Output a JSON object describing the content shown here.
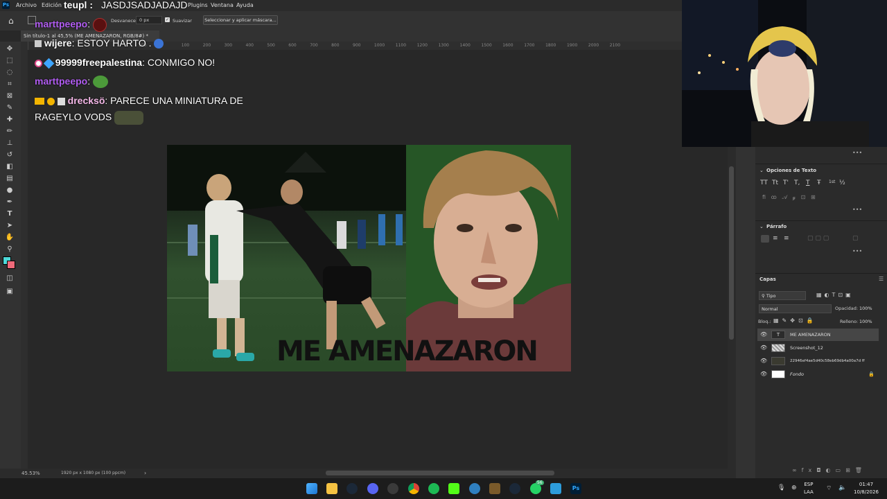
{
  "menu": {
    "items": [
      "Archivo",
      "Edición",
      "Plugins",
      "Ventana",
      "Ayuda"
    ],
    "overlay_title": "JASDJSADJADAJD"
  },
  "options_bar": {
    "feather_label": "Desvanecer:",
    "feather_value": "0 px",
    "smooth_label": "Suavizar",
    "mask_button": "Seleccionar y aplicar máscara..."
  },
  "document_tab": "Sin título-1 al 45,5% (ME AMENAZARON, RGB/8#) *",
  "ruler_ticks": [
    "100",
    "0",
    "100",
    "200",
    "300",
    "400",
    "500",
    "600",
    "700",
    "800",
    "900",
    "1000",
    "1100",
    "1200",
    "1300",
    "1400",
    "1500",
    "1600",
    "1700",
    "1800",
    "1900",
    "2000",
    "2100"
  ],
  "canvas": {
    "overlay_text": "ME AMENAZARON"
  },
  "chat": [
    {
      "user": "marttpeepo",
      "sep": ":",
      "msg": "",
      "user_color": "#b05cf0"
    },
    {
      "user": "wijere",
      "sep": ":",
      "msg": " ESTOY HARTO .",
      "user_color": "#ffffff"
    },
    {
      "user": "99999freepalestina",
      "sep": ":",
      "msg": " CONMIGO NO!",
      "user_color": "#ffffff"
    },
    {
      "user": "marttpeepo",
      "sep": ":",
      "msg": "",
      "user_color": "#b05cf0"
    },
    {
      "user": "drecksö",
      "sep": ":",
      "msg": " PARECE UNA MINIATURA DE",
      "user_color": "#f5b8e8"
    },
    {
      "user": "",
      "sep": "",
      "msg": "RAGEYLO VODS",
      "user_color": "#ffffff"
    }
  ],
  "status": {
    "zoom": "45.53%",
    "doc_info": "1920 px x 1080 px (100 ppcm)"
  },
  "text_options": {
    "title": "Opciones de Texto",
    "buttons": [
      "TT",
      "Tt",
      "T'",
      "T,",
      "T",
      "Ŧ",
      "1st",
      "½"
    ],
    "paragraph_title": "Párrafo"
  },
  "layers": {
    "title": "Capas",
    "filter": "Tipo",
    "blend_mode": "Normal",
    "opacity_label": "Opacidad:",
    "opacity_value": "100%",
    "lock_label": "Bloq.:",
    "fill_label": "Relleno:",
    "fill_value": "100%",
    "items": [
      {
        "name": "ME AMENAZARON",
        "kind": "text"
      },
      {
        "name": "Screenshot_12",
        "kind": "image"
      },
      {
        "name": "22946ef4ae5d40c58eb69db4a00a7d ff",
        "kind": "image"
      },
      {
        "name": "Fondo",
        "kind": "background"
      }
    ]
  },
  "taskbar": {
    "lang_1": "ESP",
    "lang_2": "LAA",
    "time": "01:47",
    "date": "10/8/2026",
    "badge_discord": "",
    "badge_whatsapp": "56",
    "icons": [
      "windows-start",
      "file-explorer",
      "steam",
      "discord",
      "chrome-alt",
      "chrome",
      "spotify",
      "kick",
      "ccleaner",
      "minecraft",
      "steam-2",
      "whatsapp",
      "vscode",
      "photoshop"
    ]
  },
  "colors": {
    "accent_blue": "#31a8ff",
    "foreground_color": "#4dd9d9",
    "background_color": "#f06a7a"
  }
}
